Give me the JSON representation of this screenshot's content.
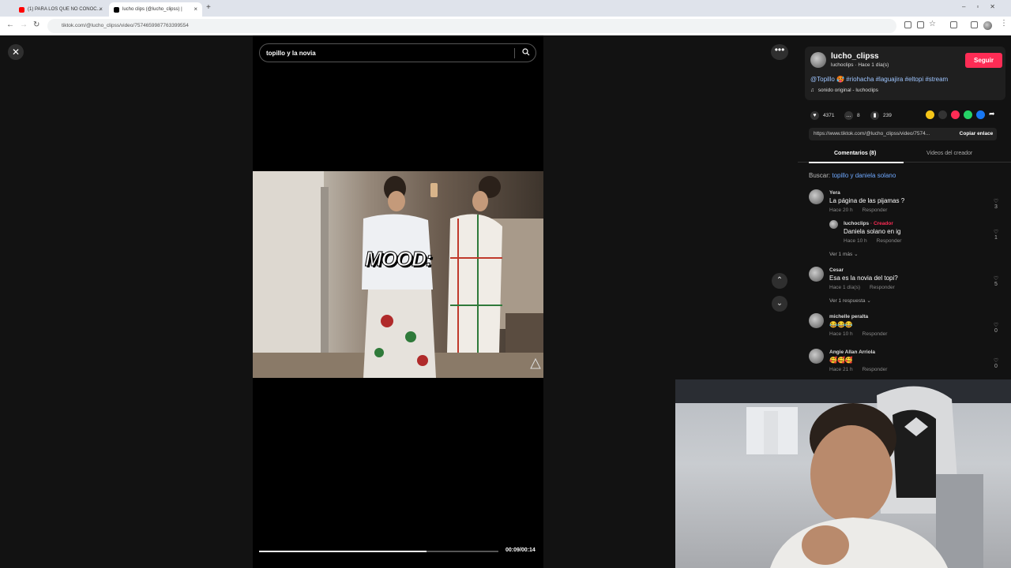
{
  "browser": {
    "tabs": [
      {
        "title": "(1) PARA LOS QUE NO CONOC…",
        "active": false,
        "favicon_color": "#ff0000"
      },
      {
        "title": "lucho clips (@lucho_clipss) |",
        "active": true,
        "favicon_color": "#000000"
      }
    ],
    "new_tab_label": "+",
    "url": "tiktok.com/@lucho_clipss/video/7574659987763399554"
  },
  "video": {
    "search_value": "topillo y la novia",
    "overlay_text": "MOOD:",
    "time": "00:09/00:14",
    "progress_fraction": 0.7
  },
  "controls": {
    "close_glyph": "✕",
    "more_glyph": "•••",
    "up_glyph": "⌃",
    "down_glyph": "⌄"
  },
  "post": {
    "username": "lucho_clipss",
    "subline": "luchoclips · Hace 1 día(s)",
    "follow_label": "Seguir",
    "caption_mention": "@Topillo",
    "caption_tags": "#riohacha #laguajira #eltopi #stream",
    "sound": "sonido original - luchoclips",
    "likes": "4371",
    "comments": "8",
    "saves": "239",
    "link": "https://www.tiktok.com/@lucho_clipss/video/7574...",
    "copy_label": "Copiar enlace"
  },
  "tabs": {
    "comments": "Comentarios (8)",
    "creator_videos": "Videos del creador"
  },
  "search_suggest": {
    "prefix": "Buscar:",
    "query": "topillo y daniela solano"
  },
  "comments": [
    {
      "name": "Yera",
      "text": "La página de las pijamas ?",
      "time": "Hace 20 h",
      "reply": "Responder",
      "likes": "3"
    },
    {
      "name": "luchoclips",
      "creator_tag": "· Creador",
      "text": "Daniela solano en ig",
      "time": "Hace 10 h",
      "reply": "Responder",
      "likes": "1"
    },
    {
      "name": "Cesar",
      "text": "Esa es la novia del topi?",
      "time": "Hace 1 día(s)",
      "reply": "Responder",
      "likes": "5"
    },
    {
      "name": "michelle peralta",
      "text": "😂😂😂",
      "time": "Hace 10 h",
      "reply": "Responder",
      "likes": "0"
    },
    {
      "name": "Angie Allan Arriola",
      "text": "🥰🥰🥰",
      "time": "Hace 21 h",
      "reply": "Responder",
      "likes": "0"
    }
  ],
  "more_links": {
    "ver_mas": "Ver 1 más",
    "ver_respuesta": "Ver 1 respuesta"
  }
}
